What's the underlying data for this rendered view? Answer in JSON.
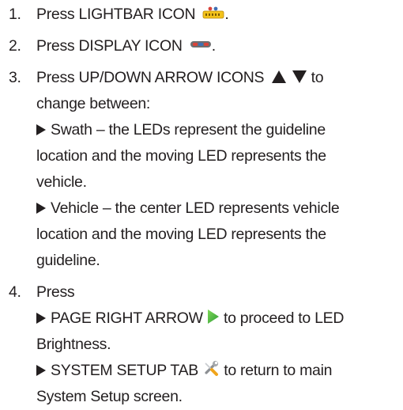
{
  "steps": [
    {
      "number": "1.",
      "text": "Press LIGHTBAR ICON",
      "icon": "lightbar-icon",
      "suffix": "."
    },
    {
      "number": "2.",
      "text": "Press DISPLAY ICON",
      "icon": "display-icon",
      "suffix": "."
    },
    {
      "number": "3.",
      "text_before": "Press UP/DOWN ARROW ICONS",
      "icons": [
        "up-arrow-icon",
        "down-arrow-icon"
      ],
      "text_after": "to",
      "line2": "change between:",
      "bullets": [
        {
          "lines": [
            "Swath – the LEDs represent the guideline",
            "location and the moving LED represents the",
            "vehicle."
          ]
        },
        {
          "lines": [
            "Vehicle – the center LED represents vehicle",
            "location and the moving LED represents the",
            "guideline."
          ]
        }
      ]
    },
    {
      "number": "4.",
      "text": "Press",
      "bullets": [
        {
          "before": "PAGE RIGHT ARROW",
          "icon": "page-right-arrow-icon",
          "after": "to proceed to LED",
          "line2": "Brightness."
        },
        {
          "before": "SYSTEM SETUP TAB",
          "icon": "system-setup-tools-icon",
          "after": "to return to main",
          "line2": "System Setup screen."
        }
      ]
    }
  ],
  "colors": {
    "text": "#231f20",
    "page_right_arrow": "#4cb848",
    "lightbar_yellow": "#f3c21a",
    "display_red": "#d9433a",
    "display_blue": "#3f6fb4"
  }
}
